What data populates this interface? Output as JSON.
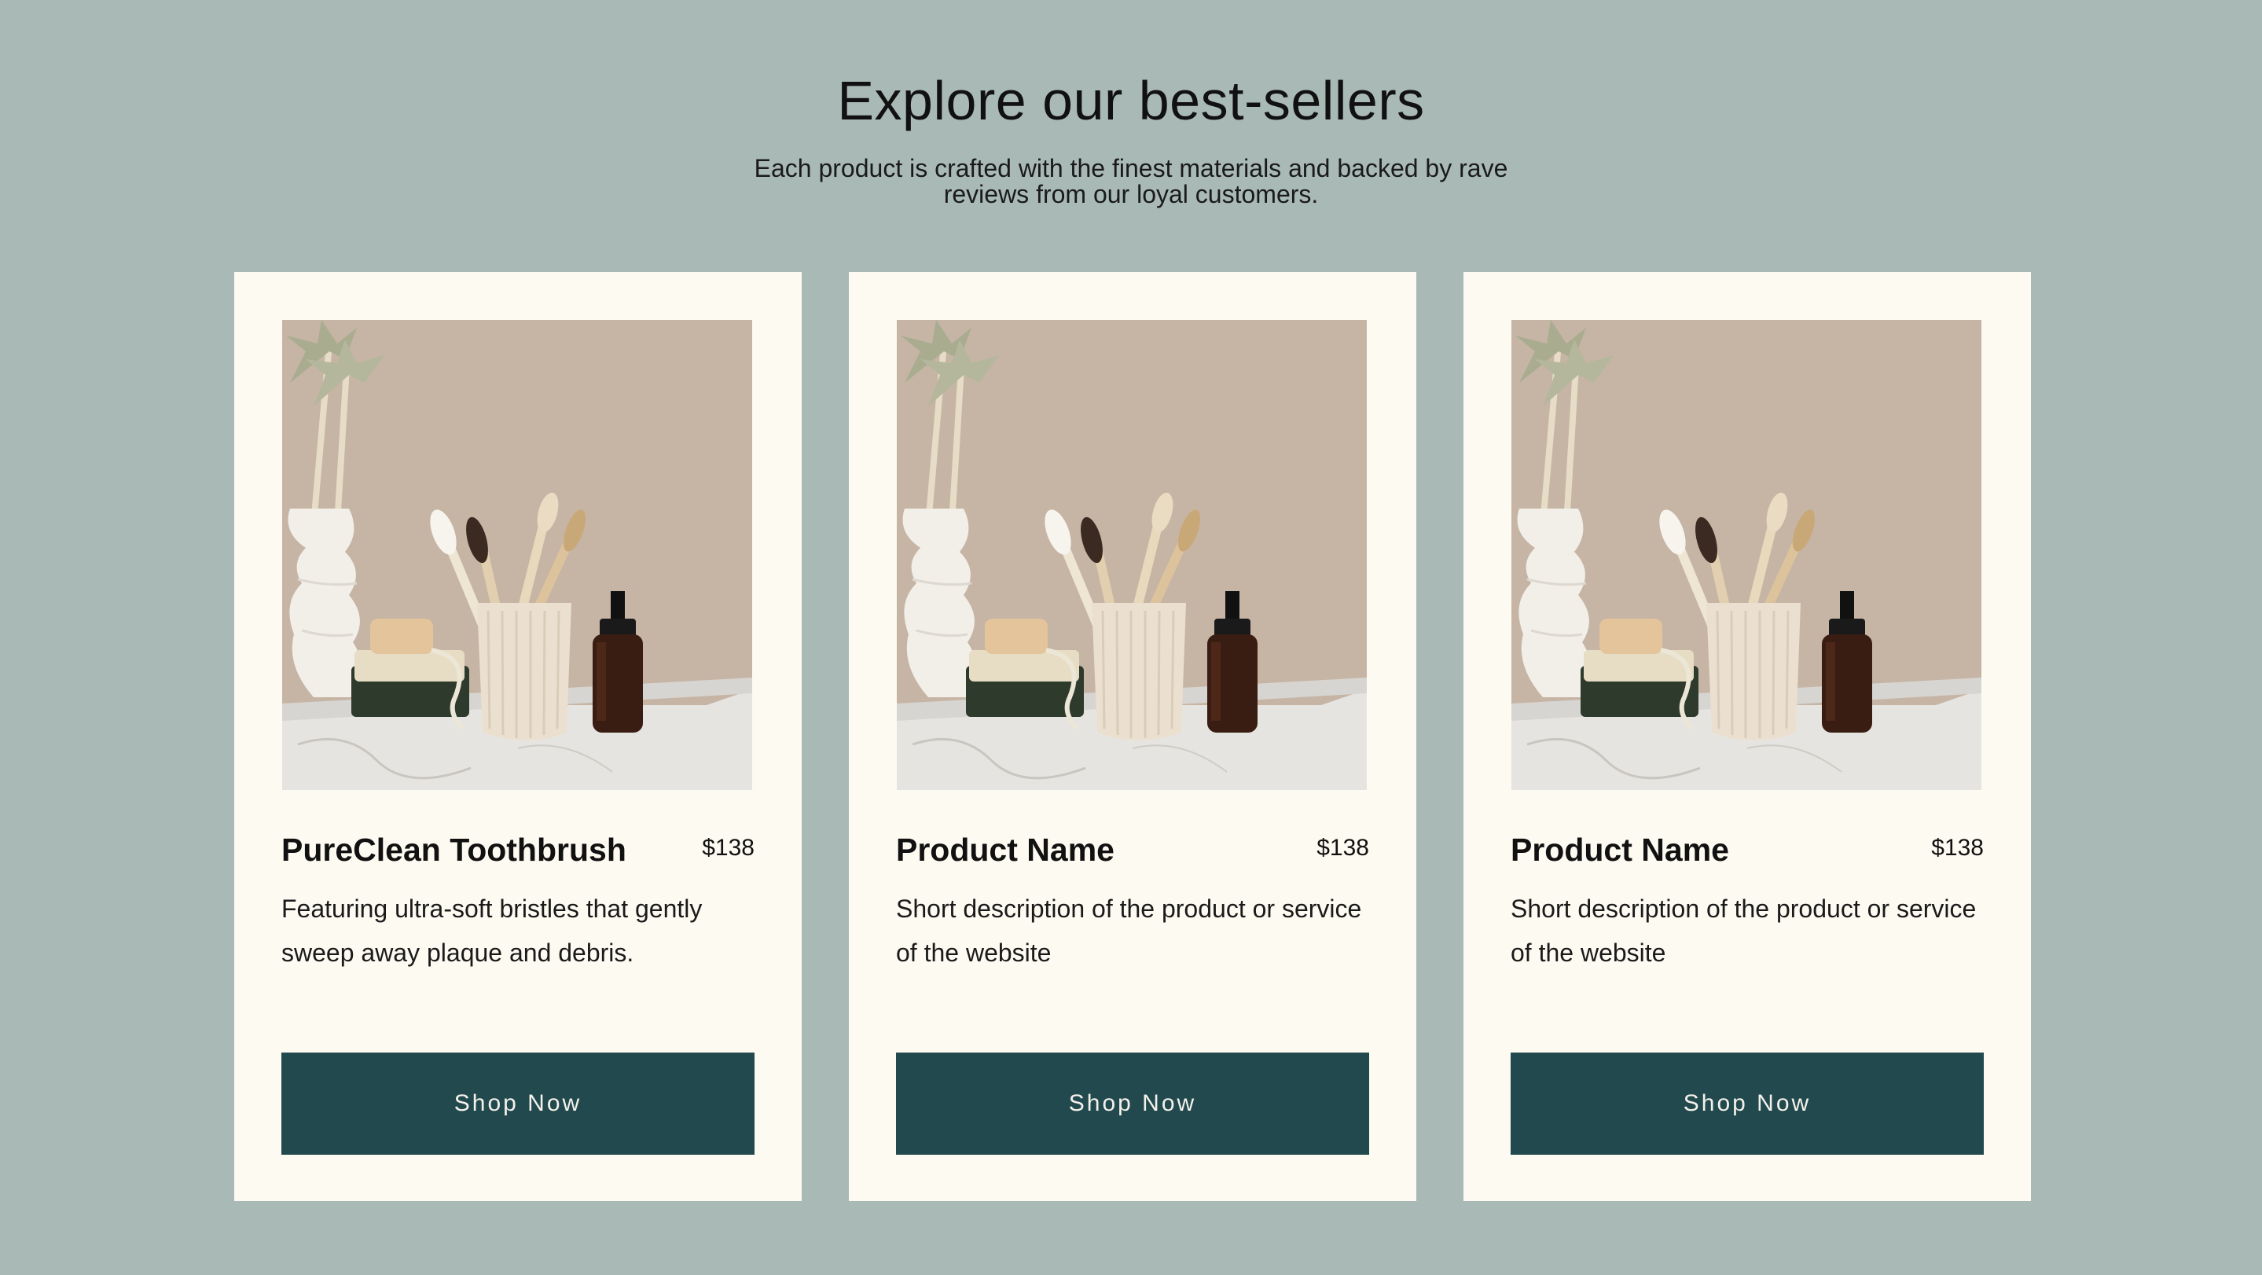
{
  "section": {
    "title": "Explore our best-sellers",
    "subtitle": "Each product is crafted with the finest materials and backed by rave reviews from our loyal customers."
  },
  "products": [
    {
      "name": "PureClean Toothbrush",
      "price": "$138",
      "description": "Featuring ultra-soft bristles that gently sweep away plaque and debris.",
      "button_label": "Shop Now",
      "image_alt": "bamboo toothbrushes in ceramic cup with vase and dropper bottle"
    },
    {
      "name": "Product Name",
      "price": "$138",
      "description": "Short description of the product or service of the website",
      "button_label": "Shop Now",
      "image_alt": "bamboo toothbrushes in ceramic cup with vase and dropper bottle"
    },
    {
      "name": "Product Name",
      "price": "$138",
      "description": "Short description of the product or service of the website",
      "button_label": "Shop Now",
      "image_alt": "bamboo toothbrushes in ceramic cup with vase and dropper bottle"
    }
  ],
  "colors": {
    "page_background": "#a9bab6",
    "card_background": "#fdfaf1",
    "button_background": "#22494e",
    "button_text": "#f3f1ea"
  }
}
